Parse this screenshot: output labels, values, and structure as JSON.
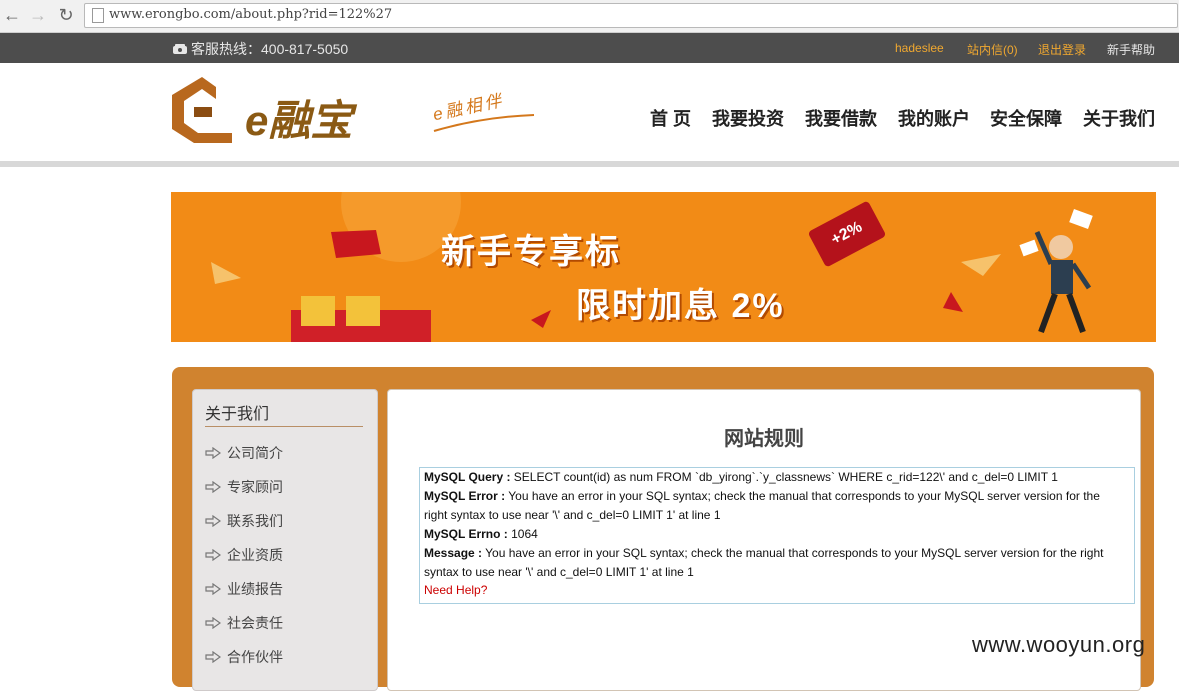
{
  "browser": {
    "url": "www.erongbo.com/about.php?rid=122%27"
  },
  "topbar": {
    "hotline_label": "客服热线：400-817-5050",
    "username": "hadeslee",
    "messages": "站内信(0)",
    "logout": "退出登录",
    "help": "新手帮助"
  },
  "header": {
    "logo_text": "e融宝",
    "slogan": "e融相伴",
    "nav": [
      "首 页",
      "我要投资",
      "我要借款",
      "我的账户",
      "安全保障",
      "关于我们"
    ]
  },
  "banner": {
    "title": "新手专享标",
    "subtitle": "限时加息 2%",
    "tag": "+2%"
  },
  "sidebar": {
    "title": "关于我们",
    "items": [
      "公司简介",
      "专家顾问",
      "联系我们",
      "企业资质",
      "业绩报告",
      "社会责任",
      "合作伙伴"
    ]
  },
  "main": {
    "title": "网站规则",
    "error": {
      "query_label": "MySQL Query :",
      "query": " SELECT count(id) as num FROM `db_yirong`.`y_classnews` WHERE c_rid=122\\' and c_del=0 LIMIT 1",
      "error_label": "MySQL Error :",
      "error_line1": " You have an error in your SQL syntax; check the manual that corresponds to your MySQL server version for the",
      "error_line2": "right syntax to use near '\\' and c_del=0 LIMIT 1' at line 1",
      "errno_label": "MySQL Errno :",
      "errno": " 1064",
      "message_label": "Message :",
      "message_line1": " You have an error in your SQL syntax; check the manual that corresponds to your MySQL server version for the right",
      "message_line2": "syntax to use near '\\' and c_del=0 LIMIT 1' at line 1",
      "help": "Need Help?"
    }
  },
  "watermark": "www.wooyun.org",
  "colors": {
    "topbar": "#4d4d4d",
    "accent_orange": "#f28b16",
    "frame": "#d0832f",
    "link_orange": "#f0a830"
  }
}
